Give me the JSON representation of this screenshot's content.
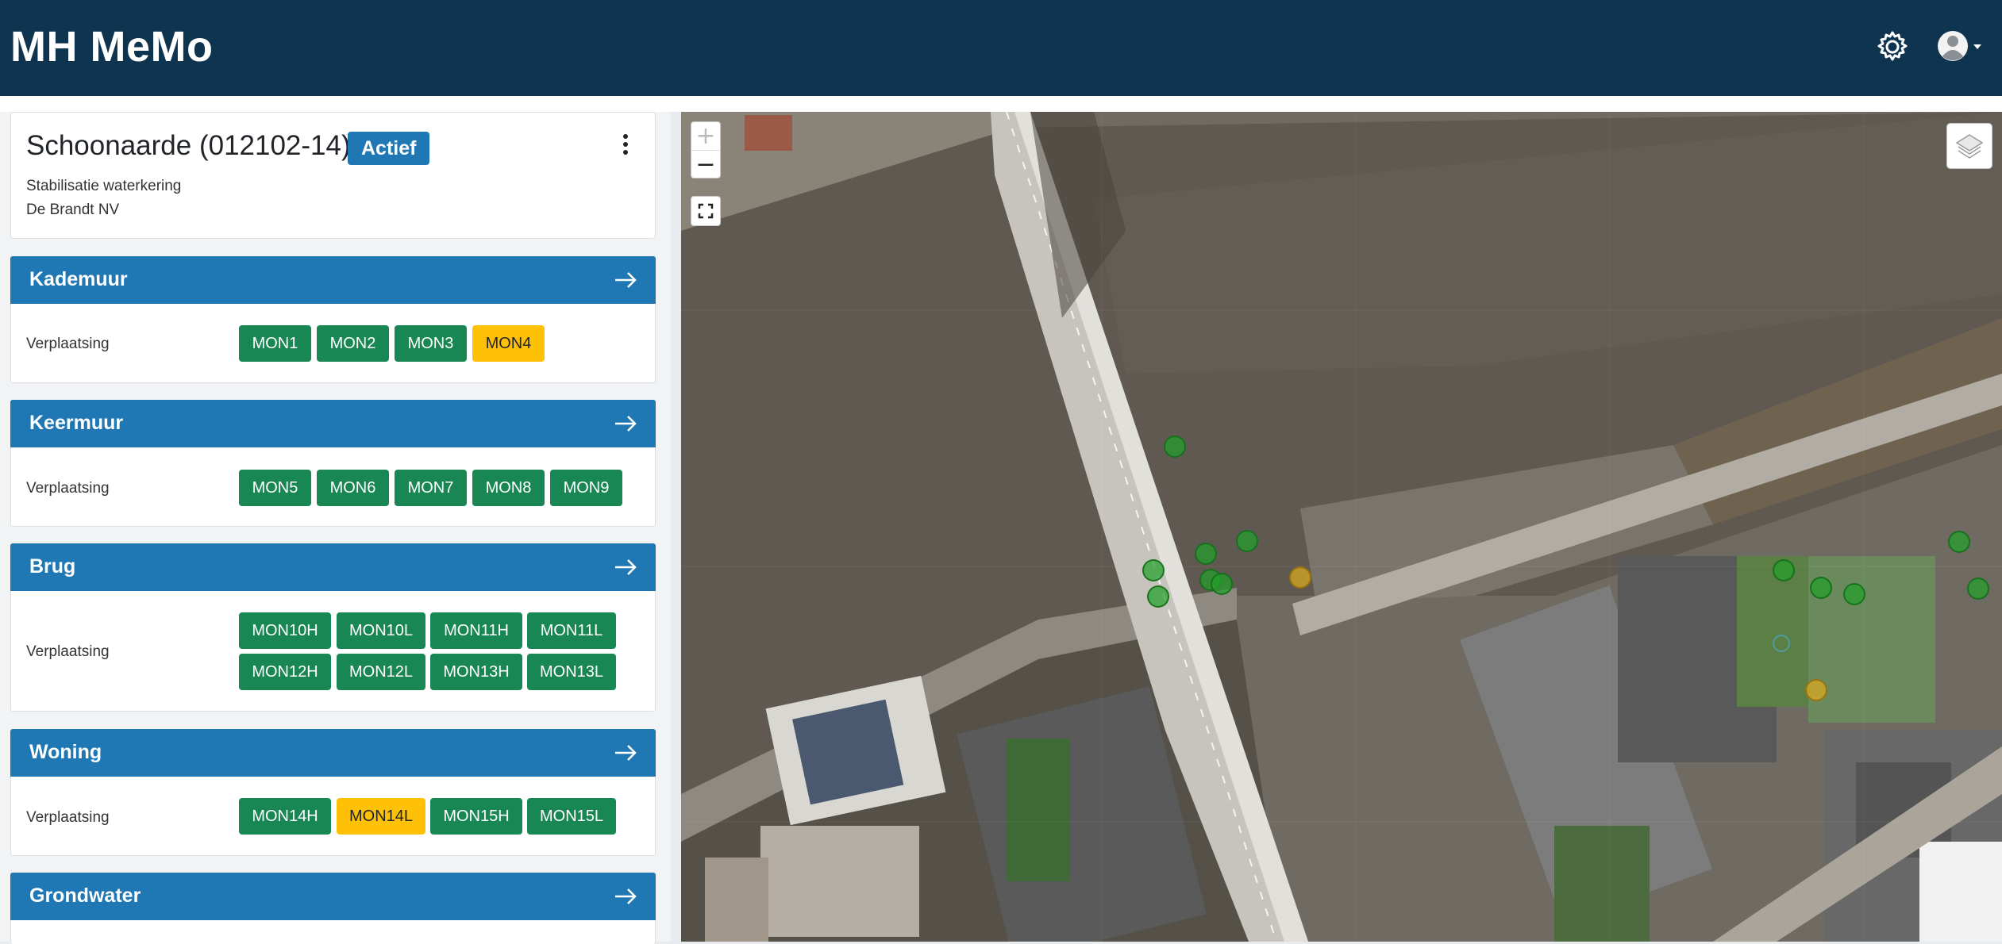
{
  "app": {
    "title": "MH MeMo"
  },
  "header": {
    "settings_icon": "gear-icon",
    "user_icon": "user-avatar-icon"
  },
  "project": {
    "name": "Schoonaarde (012102-14)",
    "status": "Actief",
    "description": "Stabilisatie waterkering",
    "company": "De Brandt NV"
  },
  "colors": {
    "header_bg": "#0f344f",
    "section_bg": "#1f78b4",
    "ok": "#198754",
    "warn": "#ffc107"
  },
  "sections": [
    {
      "title": "Kademuur",
      "label": "Verplaatsing",
      "monitors": [
        {
          "name": "MON1",
          "status": "ok"
        },
        {
          "name": "MON2",
          "status": "ok"
        },
        {
          "name": "MON3",
          "status": "ok"
        },
        {
          "name": "MON4",
          "status": "warn"
        }
      ]
    },
    {
      "title": "Keermuur",
      "label": "Verplaatsing",
      "monitors": [
        {
          "name": "MON5",
          "status": "ok"
        },
        {
          "name": "MON6",
          "status": "ok"
        },
        {
          "name": "MON7",
          "status": "ok"
        },
        {
          "name": "MON8",
          "status": "ok"
        },
        {
          "name": "MON9",
          "status": "ok"
        }
      ]
    },
    {
      "title": "Brug",
      "label": "Verplaatsing",
      "monitors": [
        {
          "name": "MON10H",
          "status": "ok"
        },
        {
          "name": "MON10L",
          "status": "ok"
        },
        {
          "name": "MON11H",
          "status": "ok"
        },
        {
          "name": "MON11L",
          "status": "ok"
        },
        {
          "name": "MON12H",
          "status": "ok"
        },
        {
          "name": "MON12L",
          "status": "ok"
        },
        {
          "name": "MON13H",
          "status": "ok"
        },
        {
          "name": "MON13L",
          "status": "ok"
        }
      ]
    },
    {
      "title": "Woning",
      "label": "Verplaatsing",
      "monitors": [
        {
          "name": "MON14H",
          "status": "ok"
        },
        {
          "name": "MON14L",
          "status": "warn"
        },
        {
          "name": "MON15H",
          "status": "ok"
        },
        {
          "name": "MON15L",
          "status": "ok"
        }
      ]
    },
    {
      "title": "Grondwater"
    }
  ],
  "map": {
    "zoom_in": "+",
    "zoom_out": "−",
    "fullscreen_icon": "fullscreen-icon",
    "layers_icon": "layers-icon",
    "marker_statuses": [
      "ok",
      "ok",
      "ok",
      "ok",
      "ok",
      "ok",
      "ok",
      "warn",
      "ok",
      "ok",
      "ok",
      "ok",
      "ok",
      "warn"
    ]
  }
}
